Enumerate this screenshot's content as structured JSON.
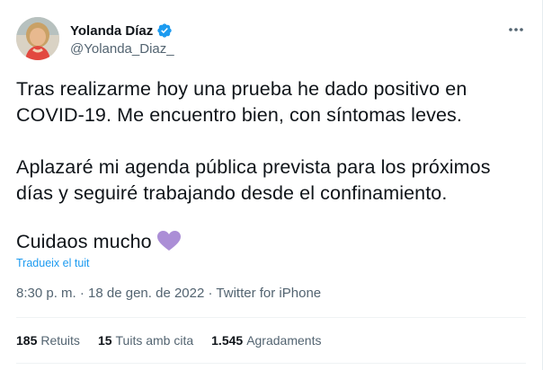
{
  "author": {
    "display_name": "Yolanda Díaz",
    "handle": "@Yolanda_Diaz_",
    "verified": true,
    "avatar_icon": "profile-photo"
  },
  "menu_icon": "more-dots-icon",
  "tweet": {
    "paragraph1": "Tras realizarme hoy una prueba he dado positivo en COVID-19. Me encuentro bien, con síntomas leves.",
    "paragraph2": "Aplazaré mi agenda pública prevista para los próximos días y seguiré trabajando desde el confinamiento.",
    "paragraph3": "Cuidaos mucho",
    "emoji": "purple-heart",
    "emoji_color": "#ab8ed6",
    "translate_link": "Tradueix el tuit"
  },
  "meta": {
    "time": "8:30 p. m.",
    "date": "18 de gen. de 2022",
    "source": "Twitter for iPhone",
    "separator": "·"
  },
  "stats": {
    "retweets_count": "185",
    "retweets_label": "Retuits",
    "quotes_count": "15",
    "quotes_label": "Tuits amb cita",
    "likes_count": "1.545",
    "likes_label": "Agradaments"
  },
  "colors": {
    "accent": "#1d9bf0",
    "text": "#0f1419",
    "secondary": "#536471"
  }
}
